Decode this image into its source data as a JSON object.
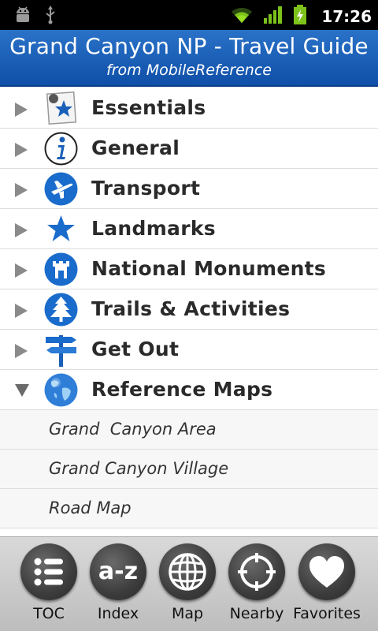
{
  "status_bar": {
    "icons": [
      "android-debug-icon",
      "usb-icon",
      "wifi-icon",
      "signal-icon",
      "battery-charging-icon"
    ],
    "time": "17:26"
  },
  "header": {
    "title": "Grand Canyon NP - Travel Guide",
    "subtitle": "from MobileReference",
    "color": "#1a5fb8"
  },
  "menu": {
    "items": [
      {
        "label": "Essentials",
        "icon": "essentials-star-card-icon",
        "expanded": false
      },
      {
        "label": "General",
        "icon": "info-icon",
        "expanded": false
      },
      {
        "label": "Transport",
        "icon": "airplane-icon",
        "expanded": false
      },
      {
        "label": "Landmarks",
        "icon": "star-icon",
        "expanded": false
      },
      {
        "label": "National Monuments",
        "icon": "tower-icon",
        "expanded": false
      },
      {
        "label": "Trails & Activities",
        "icon": "tree-icon",
        "expanded": false
      },
      {
        "label": "Get Out",
        "icon": "signpost-icon",
        "expanded": false
      },
      {
        "label": "Reference Maps",
        "icon": "globe-icon",
        "expanded": true
      }
    ],
    "sub_items": [
      {
        "label": "Grand  Canyon Area"
      },
      {
        "label": "Grand Canyon Village"
      },
      {
        "label": "Road Map"
      }
    ]
  },
  "toolbar": {
    "buttons": [
      {
        "label": "TOC",
        "icon": "list-icon"
      },
      {
        "label": "Index",
        "icon": "a-z-icon",
        "glyph": "a-z"
      },
      {
        "label": "Map",
        "icon": "globe-grid-icon"
      },
      {
        "label": "Nearby",
        "icon": "crosshair-icon"
      },
      {
        "label": "Favorites",
        "icon": "heart-icon"
      }
    ]
  }
}
